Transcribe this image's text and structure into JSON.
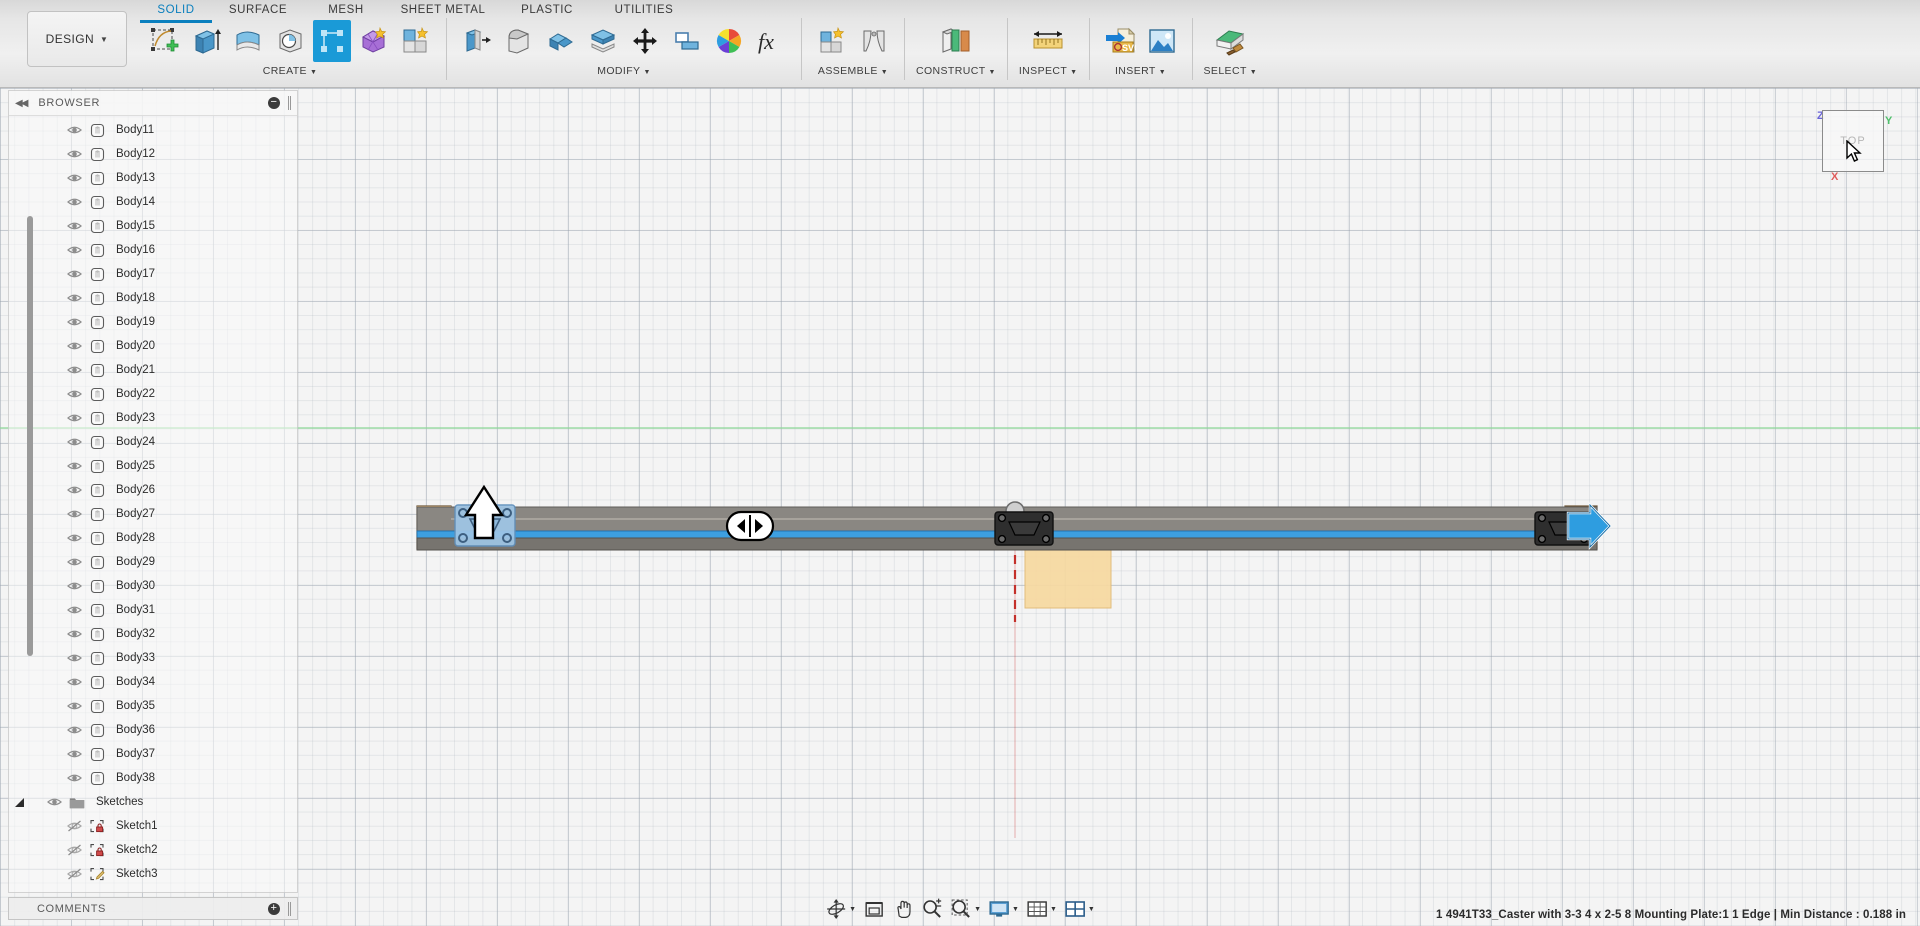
{
  "app": {
    "workspace_label": "DESIGN",
    "workspace_caret": "▼"
  },
  "ribbon": {
    "tabs": [
      {
        "label": "SOLID",
        "active": true
      },
      {
        "label": "SURFACE",
        "active": false
      },
      {
        "label": "MESH",
        "active": false
      },
      {
        "label": "SHEET METAL",
        "active": false
      },
      {
        "label": "PLASTIC",
        "active": false
      },
      {
        "label": "UTILITIES",
        "active": false
      }
    ],
    "panels": [
      {
        "title": "CREATE",
        "caret": "▼",
        "tools": [
          {
            "name": "create-sketch-icon",
            "label": "Create Sketch"
          },
          {
            "name": "extrude-icon",
            "label": "Extrude"
          },
          {
            "name": "revolve-icon",
            "label": "Revolve"
          },
          {
            "name": "hole-icon",
            "label": "Hole"
          },
          {
            "name": "rectangular-pattern-icon",
            "label": "Rectangular Pattern",
            "selected": true
          },
          {
            "name": "create-form-icon",
            "label": "Create Form"
          },
          {
            "name": "create-box-icon",
            "label": "Create Box"
          }
        ]
      },
      {
        "title": "MODIFY",
        "caret": "▼",
        "tools": [
          {
            "name": "press-pull-icon",
            "label": "Press Pull"
          },
          {
            "name": "fillet-icon",
            "label": "Fillet"
          },
          {
            "name": "shell-icon",
            "label": "Shell"
          },
          {
            "name": "offset-face-icon",
            "label": "Offset Face"
          },
          {
            "name": "move-copy-icon",
            "label": "Move/Copy"
          },
          {
            "name": "align-icon",
            "label": "Align"
          },
          {
            "name": "appearance-icon",
            "label": "Appearance"
          },
          {
            "name": "change-parameters-icon",
            "label": "Change Parameters"
          }
        ]
      },
      {
        "title": "ASSEMBLE",
        "caret": "▼",
        "tools": [
          {
            "name": "new-component-icon",
            "label": "New Component"
          },
          {
            "name": "joint-icon",
            "label": "Joint"
          }
        ]
      },
      {
        "title": "CONSTRUCT",
        "caret": "▼",
        "tools": [
          {
            "name": "offset-plane-icon",
            "label": "Offset Plane"
          }
        ]
      },
      {
        "title": "INSPECT",
        "caret": "▼",
        "tools": [
          {
            "name": "measure-icon",
            "label": "Measure"
          }
        ]
      },
      {
        "title": "INSERT",
        "caret": "▼",
        "tools": [
          {
            "name": "insert-svg-icon",
            "label": "Insert SVG"
          },
          {
            "name": "canvas-image-icon",
            "label": "Canvas"
          }
        ]
      },
      {
        "title": "SELECT",
        "caret": "▼",
        "tools": [
          {
            "name": "select-paint-icon",
            "label": "Select"
          }
        ]
      }
    ]
  },
  "browser": {
    "title": "BROWSER",
    "collapse_icon": "◀◀",
    "minimize_icon": "−",
    "tree": [
      {
        "label": "Body11",
        "type": "body",
        "visible": true,
        "indent": 2
      },
      {
        "label": "Body12",
        "type": "body",
        "visible": true,
        "indent": 2
      },
      {
        "label": "Body13",
        "type": "body",
        "visible": true,
        "indent": 2
      },
      {
        "label": "Body14",
        "type": "body",
        "visible": true,
        "indent": 2
      },
      {
        "label": "Body15",
        "type": "body",
        "visible": true,
        "indent": 2
      },
      {
        "label": "Body16",
        "type": "body",
        "visible": true,
        "indent": 2
      },
      {
        "label": "Body17",
        "type": "body",
        "visible": true,
        "indent": 2
      },
      {
        "label": "Body18",
        "type": "body",
        "visible": true,
        "indent": 2
      },
      {
        "label": "Body19",
        "type": "body",
        "visible": true,
        "indent": 2
      },
      {
        "label": "Body20",
        "type": "body",
        "visible": true,
        "indent": 2
      },
      {
        "label": "Body21",
        "type": "body",
        "visible": true,
        "indent": 2
      },
      {
        "label": "Body22",
        "type": "body",
        "visible": true,
        "indent": 2
      },
      {
        "label": "Body23",
        "type": "body",
        "visible": true,
        "indent": 2
      },
      {
        "label": "Body24",
        "type": "body",
        "visible": true,
        "indent": 2
      },
      {
        "label": "Body25",
        "type": "body",
        "visible": true,
        "indent": 2
      },
      {
        "label": "Body26",
        "type": "body",
        "visible": true,
        "indent": 2
      },
      {
        "label": "Body27",
        "type": "body",
        "visible": true,
        "indent": 2
      },
      {
        "label": "Body28",
        "type": "body",
        "visible": true,
        "indent": 2
      },
      {
        "label": "Body29",
        "type": "body",
        "visible": true,
        "indent": 2
      },
      {
        "label": "Body30",
        "type": "body",
        "visible": true,
        "indent": 2
      },
      {
        "label": "Body31",
        "type": "body",
        "visible": true,
        "indent": 2
      },
      {
        "label": "Body32",
        "type": "body",
        "visible": true,
        "indent": 2
      },
      {
        "label": "Body33",
        "type": "body",
        "visible": true,
        "indent": 2
      },
      {
        "label": "Body34",
        "type": "body",
        "visible": true,
        "indent": 2
      },
      {
        "label": "Body35",
        "type": "body",
        "visible": true,
        "indent": 2
      },
      {
        "label": "Body36",
        "type": "body",
        "visible": true,
        "indent": 2
      },
      {
        "label": "Body37",
        "type": "body",
        "visible": true,
        "indent": 2
      },
      {
        "label": "Body38",
        "type": "body",
        "visible": true,
        "indent": 2
      },
      {
        "label": "Sketches",
        "type": "folder",
        "visible": true,
        "indent": 1,
        "expanded": true
      },
      {
        "label": "Sketch1",
        "type": "sketch-locked",
        "visible": false,
        "indent": 2
      },
      {
        "label": "Sketch2",
        "type": "sketch-locked",
        "visible": false,
        "indent": 2
      },
      {
        "label": "Sketch3",
        "type": "sketch-active",
        "visible": false,
        "indent": 2
      }
    ]
  },
  "viewcube": {
    "face_label": "TOP",
    "axis_z": "Z",
    "axis_x": "X",
    "axis_y": "Y"
  },
  "model": {
    "description": "Long horizontal extrusion beam with caster mounting plates",
    "wood_color": "#c49a5e",
    "metal_color": "#8d8a85",
    "highlight_color": "#3d9fe0",
    "sketch_fill_color": "#f7d9a0",
    "construction_line_color": "#c4302b",
    "manipulators": [
      {
        "name": "arrow-up-manipulator",
        "direction": "up"
      },
      {
        "name": "arrow-left-right-manipulator",
        "direction": "left-right"
      },
      {
        "name": "arrow-right-manipulator",
        "direction": "right"
      }
    ]
  },
  "comments": {
    "title": "COMMENTS",
    "add_icon": "+"
  },
  "navbar": {
    "buttons": [
      {
        "name": "orbit-icon",
        "label": "Orbit",
        "dropdown": true
      },
      {
        "name": "look-at-icon",
        "label": "Look At",
        "dropdown": false
      },
      {
        "name": "pan-icon",
        "label": "Pan",
        "dropdown": false
      },
      {
        "name": "zoom-icon",
        "label": "Zoom",
        "dropdown": false
      },
      {
        "name": "fit-icon",
        "label": "Fit",
        "dropdown": true
      },
      {
        "name": "display-settings-icon",
        "label": "Display Settings",
        "dropdown": true
      },
      {
        "name": "grid-snaps-icon",
        "label": "Grid and Snaps",
        "dropdown": true
      },
      {
        "name": "viewport-layout-icon",
        "label": "Viewports",
        "dropdown": true
      }
    ]
  },
  "statusbar": {
    "text": "1 4941T33_Caster with 3-3 4 x 2-5 8 Mounting Plate:1 1 Edge | Min Distance : 0.188 in"
  }
}
